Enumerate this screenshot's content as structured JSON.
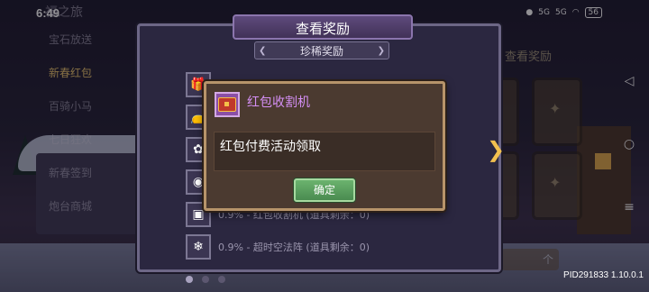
{
  "status_bar": {
    "time": "6:49",
    "signal_1": "5G",
    "signal_2": "5G",
    "battery": "56"
  },
  "background": {
    "title": "福之旅",
    "menu": [
      "宝石放送",
      "新春红包",
      "百骑小马",
      "七日狂欢",
      "新春签到",
      "炮台商城"
    ],
    "active_menu_index": 1,
    "right_header": "查看奖励",
    "right_confirm": "个"
  },
  "reward_panel": {
    "title": "查看奖励",
    "subtitle": "珍稀奖励",
    "rows": [
      {
        "icon": "gift-icon",
        "text": ""
      },
      {
        "icon": "bag-icon",
        "text": ""
      },
      {
        "icon": "creature-icon",
        "text": ""
      },
      {
        "icon": "orb-icon",
        "text": ""
      },
      {
        "icon": "chest-icon",
        "text": "0.9% - 红包收割机 (道具剩余：0)"
      },
      {
        "icon": "snowflake-icon",
        "text": "0.9% - 超时空法阵 (道具剩余：0)"
      }
    ],
    "pages": 3,
    "current_page": 0
  },
  "dialog": {
    "title": "红包收割机",
    "description": "红包付费活动领取",
    "confirm_label": "确定"
  },
  "footer": {
    "pid": "PID291833  1.10.0.1"
  },
  "colors": {
    "dialog_title": "#d48ff5",
    "confirm_green": "#5a9e5e",
    "panel_bg": "#2b2740"
  }
}
